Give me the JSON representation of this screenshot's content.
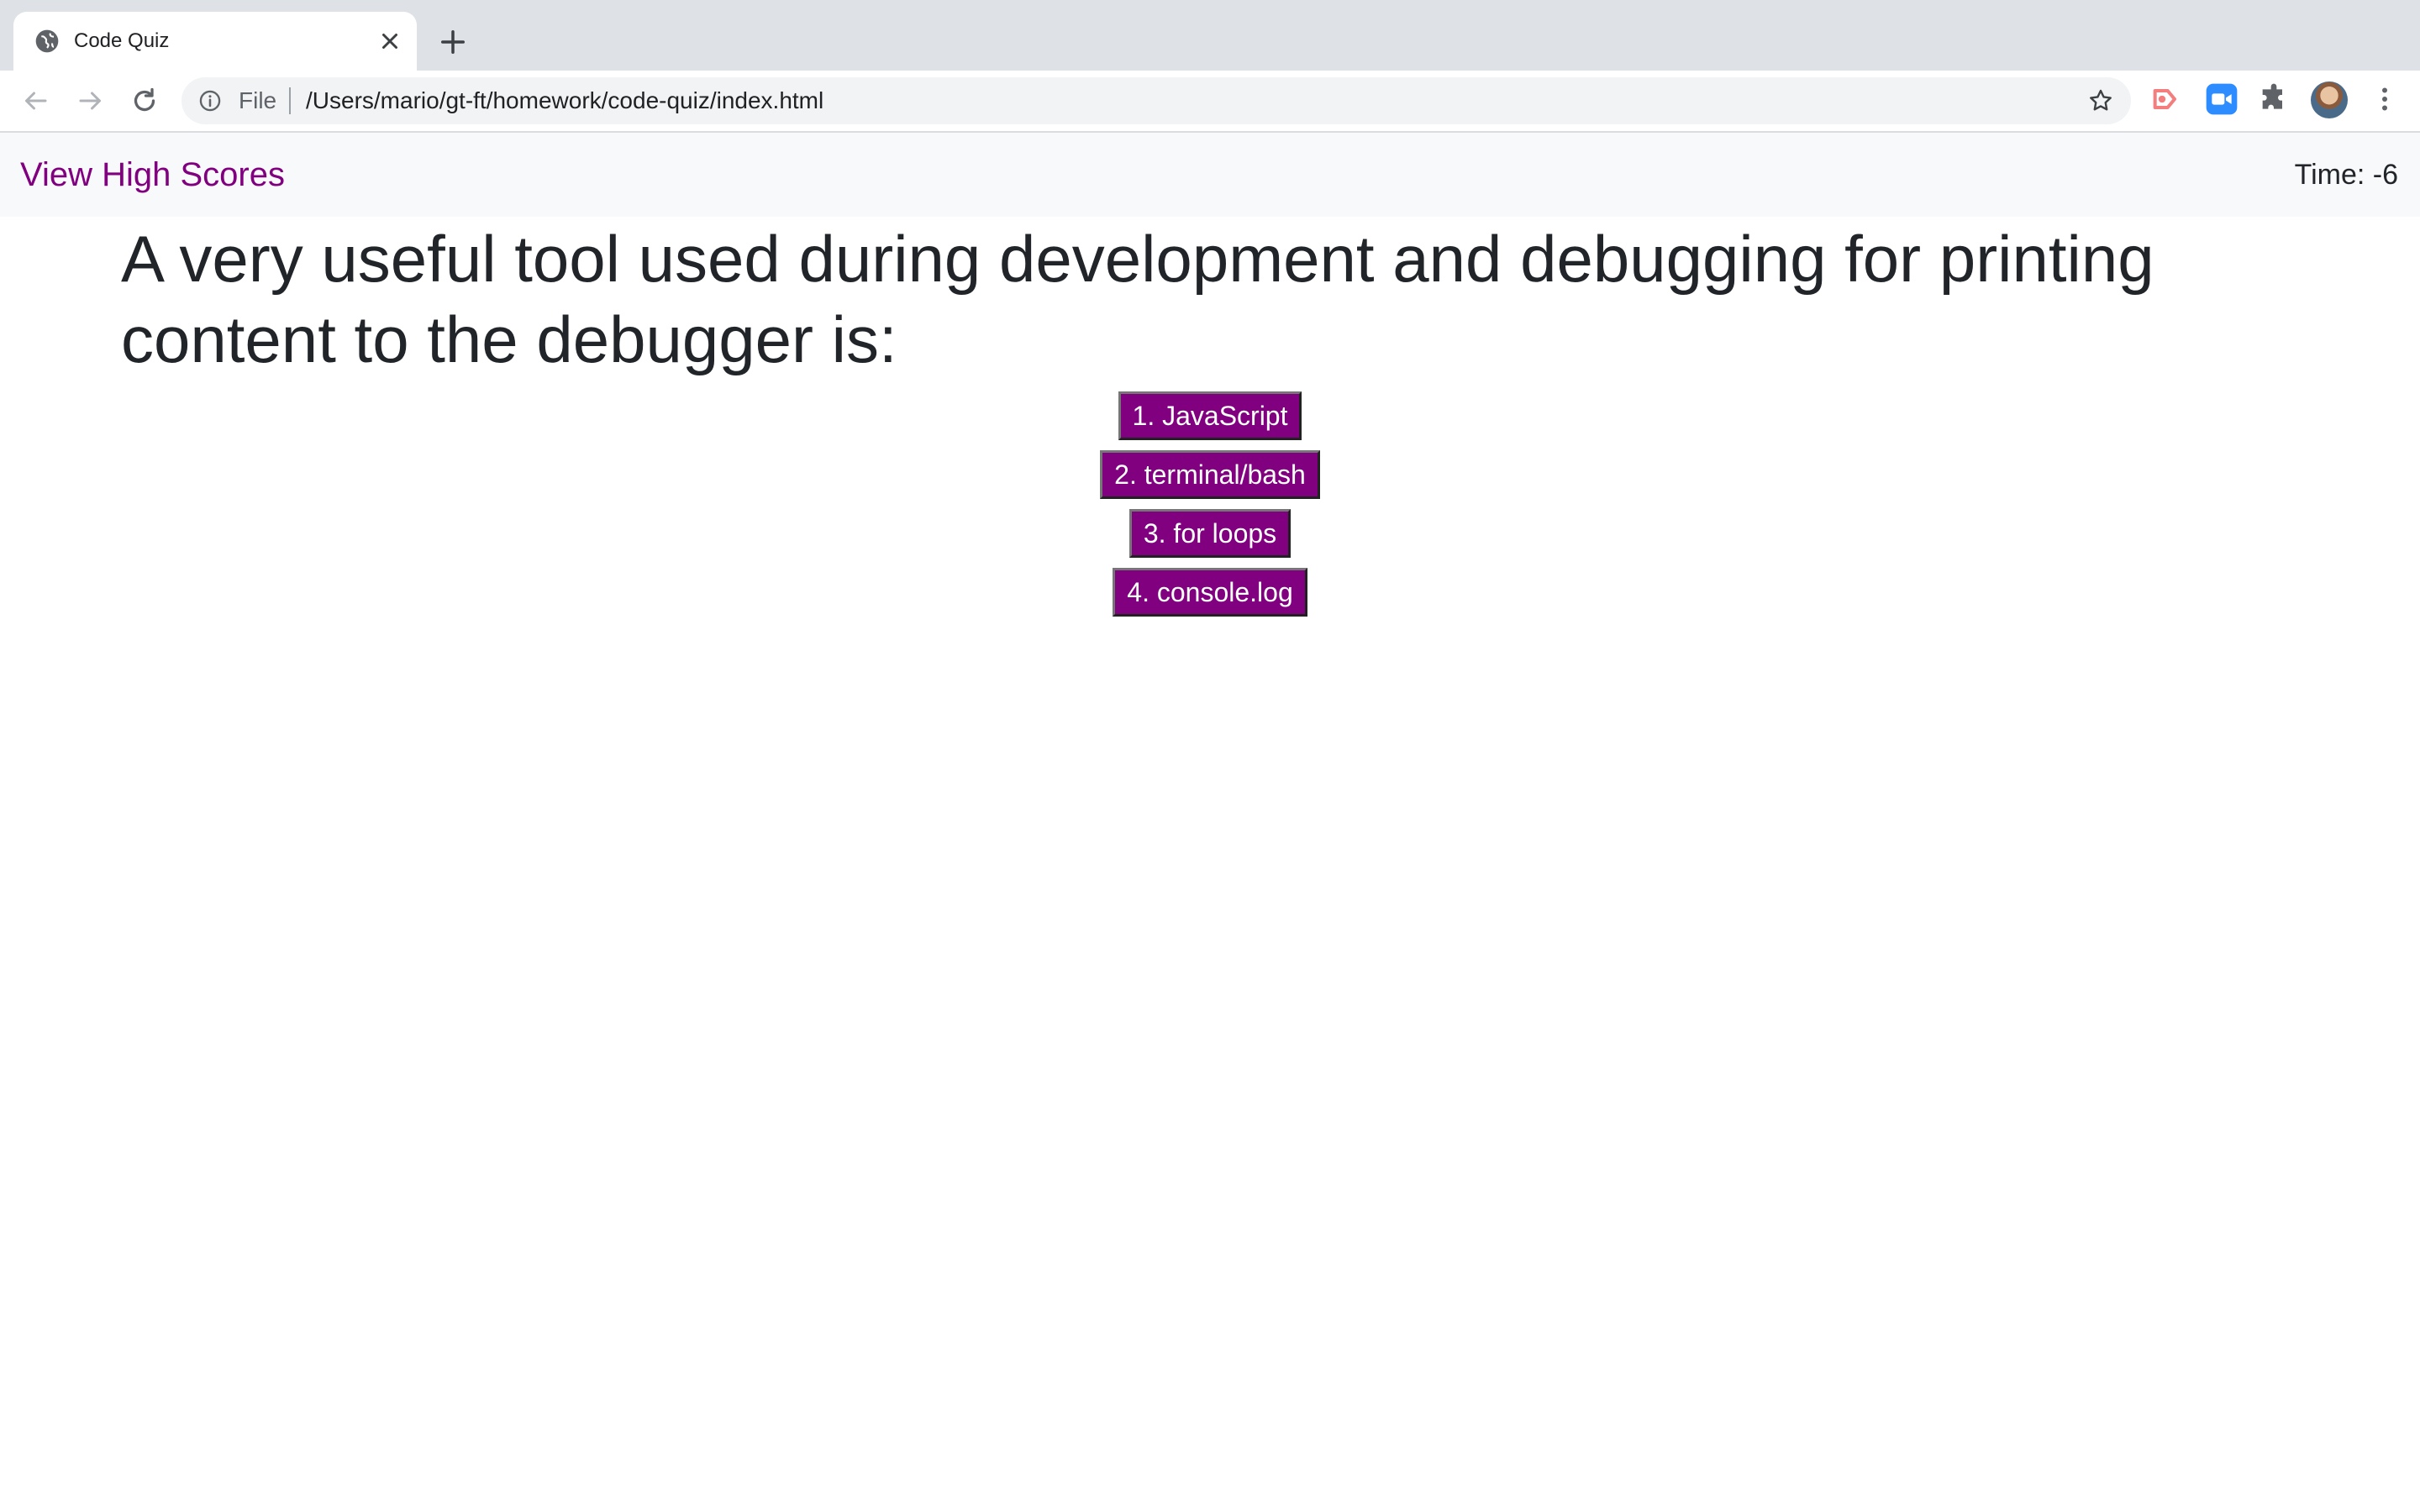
{
  "browser": {
    "tab_title": "Code Quiz",
    "url_scheme": "File",
    "url": "/Users/mario/gt-ft/homework/code-quiz/index.html"
  },
  "navbar": {
    "high_scores_label": "View High Scores",
    "timer_label": "Time: -6"
  },
  "quiz": {
    "question": "A very useful tool used during development and debugging for printing content to the debugger is:",
    "answers": [
      {
        "label": "1. JavaScript"
      },
      {
        "label": "2. terminal/bash"
      },
      {
        "label": "3. for loops"
      },
      {
        "label": "4. console.log"
      }
    ]
  },
  "colors": {
    "accent": "#800080",
    "text": "#212529",
    "navbar_bg": "#f8f9fa"
  }
}
